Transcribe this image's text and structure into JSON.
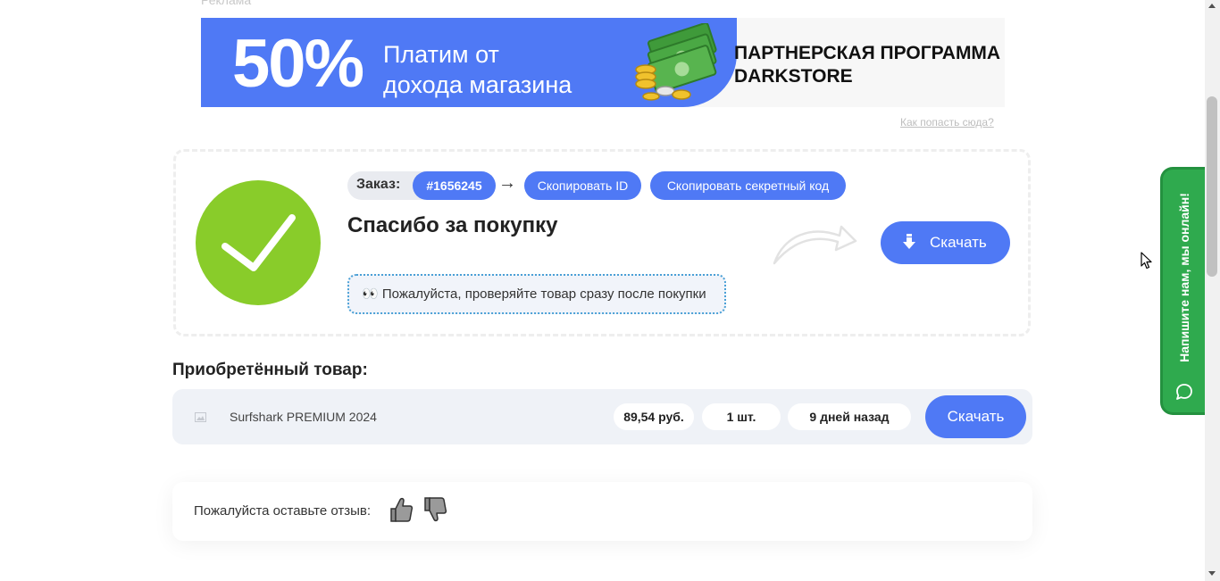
{
  "ad": {
    "label": "Реклама",
    "percent": "50%",
    "line1": "Платим от",
    "line2": "дохода магазина",
    "right_line1": "ПАРТНЕРСКАЯ ПРОГРАММА",
    "right_line2": "DARKSTORE",
    "how_link": "Как попасть сюда?"
  },
  "order": {
    "label": "Заказ:",
    "id": "#1656245",
    "arrow": "→",
    "copy_id": "Скопировать ID",
    "copy_secret": "Скопировать секретный код",
    "thanks": "Спасибо за покупку",
    "notice_icon": "👀",
    "notice": "Пожалуйста, проверяйте товар сразу после покупки",
    "download": "Скачать"
  },
  "purchased": {
    "title": "Приобретённый товар:",
    "items": [
      {
        "name": "Surfshark PREMIUM 2024",
        "price": "89,54 руб.",
        "qty": "1 шт.",
        "date": "9 дней назад",
        "download": "Скачать"
      }
    ]
  },
  "review": {
    "label": "Пожалуйста оставьте отзыв:"
  },
  "chat": {
    "label": "Напишите нам, мы онлайн!"
  },
  "colors": {
    "accent": "#4f79f5",
    "success": "#89cc2a",
    "chat": "#2faa4e"
  },
  "icons": [
    "check-icon",
    "download-icon",
    "curved-arrow-icon",
    "image-icon",
    "thumbs-up-icon",
    "thumbs-down-icon",
    "chat-bubble-icon"
  ]
}
